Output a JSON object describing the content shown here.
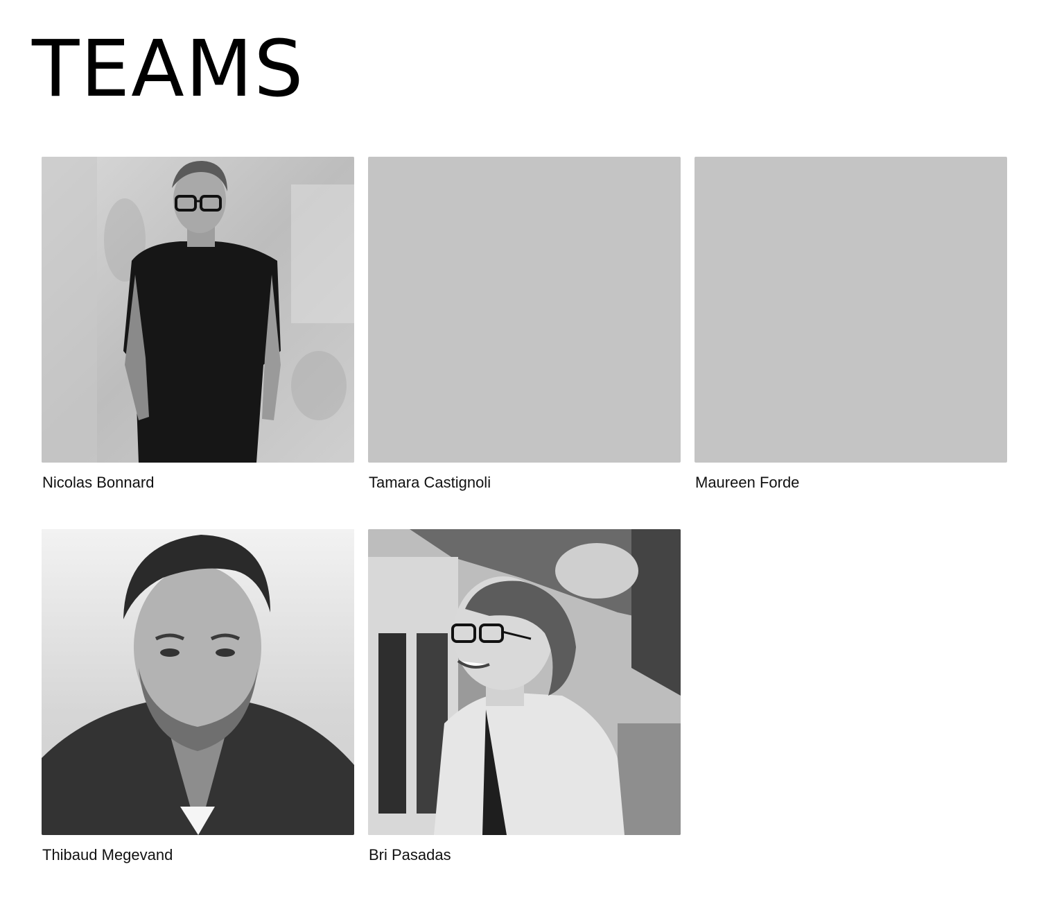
{
  "page": {
    "title": "TEAMS"
  },
  "team": {
    "members": [
      {
        "name": "Nicolas Bonnard",
        "photo": "portrait-man-leaning-on-wall"
      },
      {
        "name": "Tamara Castignoli",
        "photo": "placeholder"
      },
      {
        "name": "Maureen Forde",
        "photo": "placeholder"
      },
      {
        "name": "Thibaud Megevand",
        "photo": "portrait-man-denim-jacket"
      },
      {
        "name": "Bri Pasadas",
        "photo": "portrait-woman-laughing-glasses"
      }
    ]
  },
  "colors": {
    "placeholder": "#c4c4c4",
    "text": "#000000",
    "background": "#ffffff"
  }
}
